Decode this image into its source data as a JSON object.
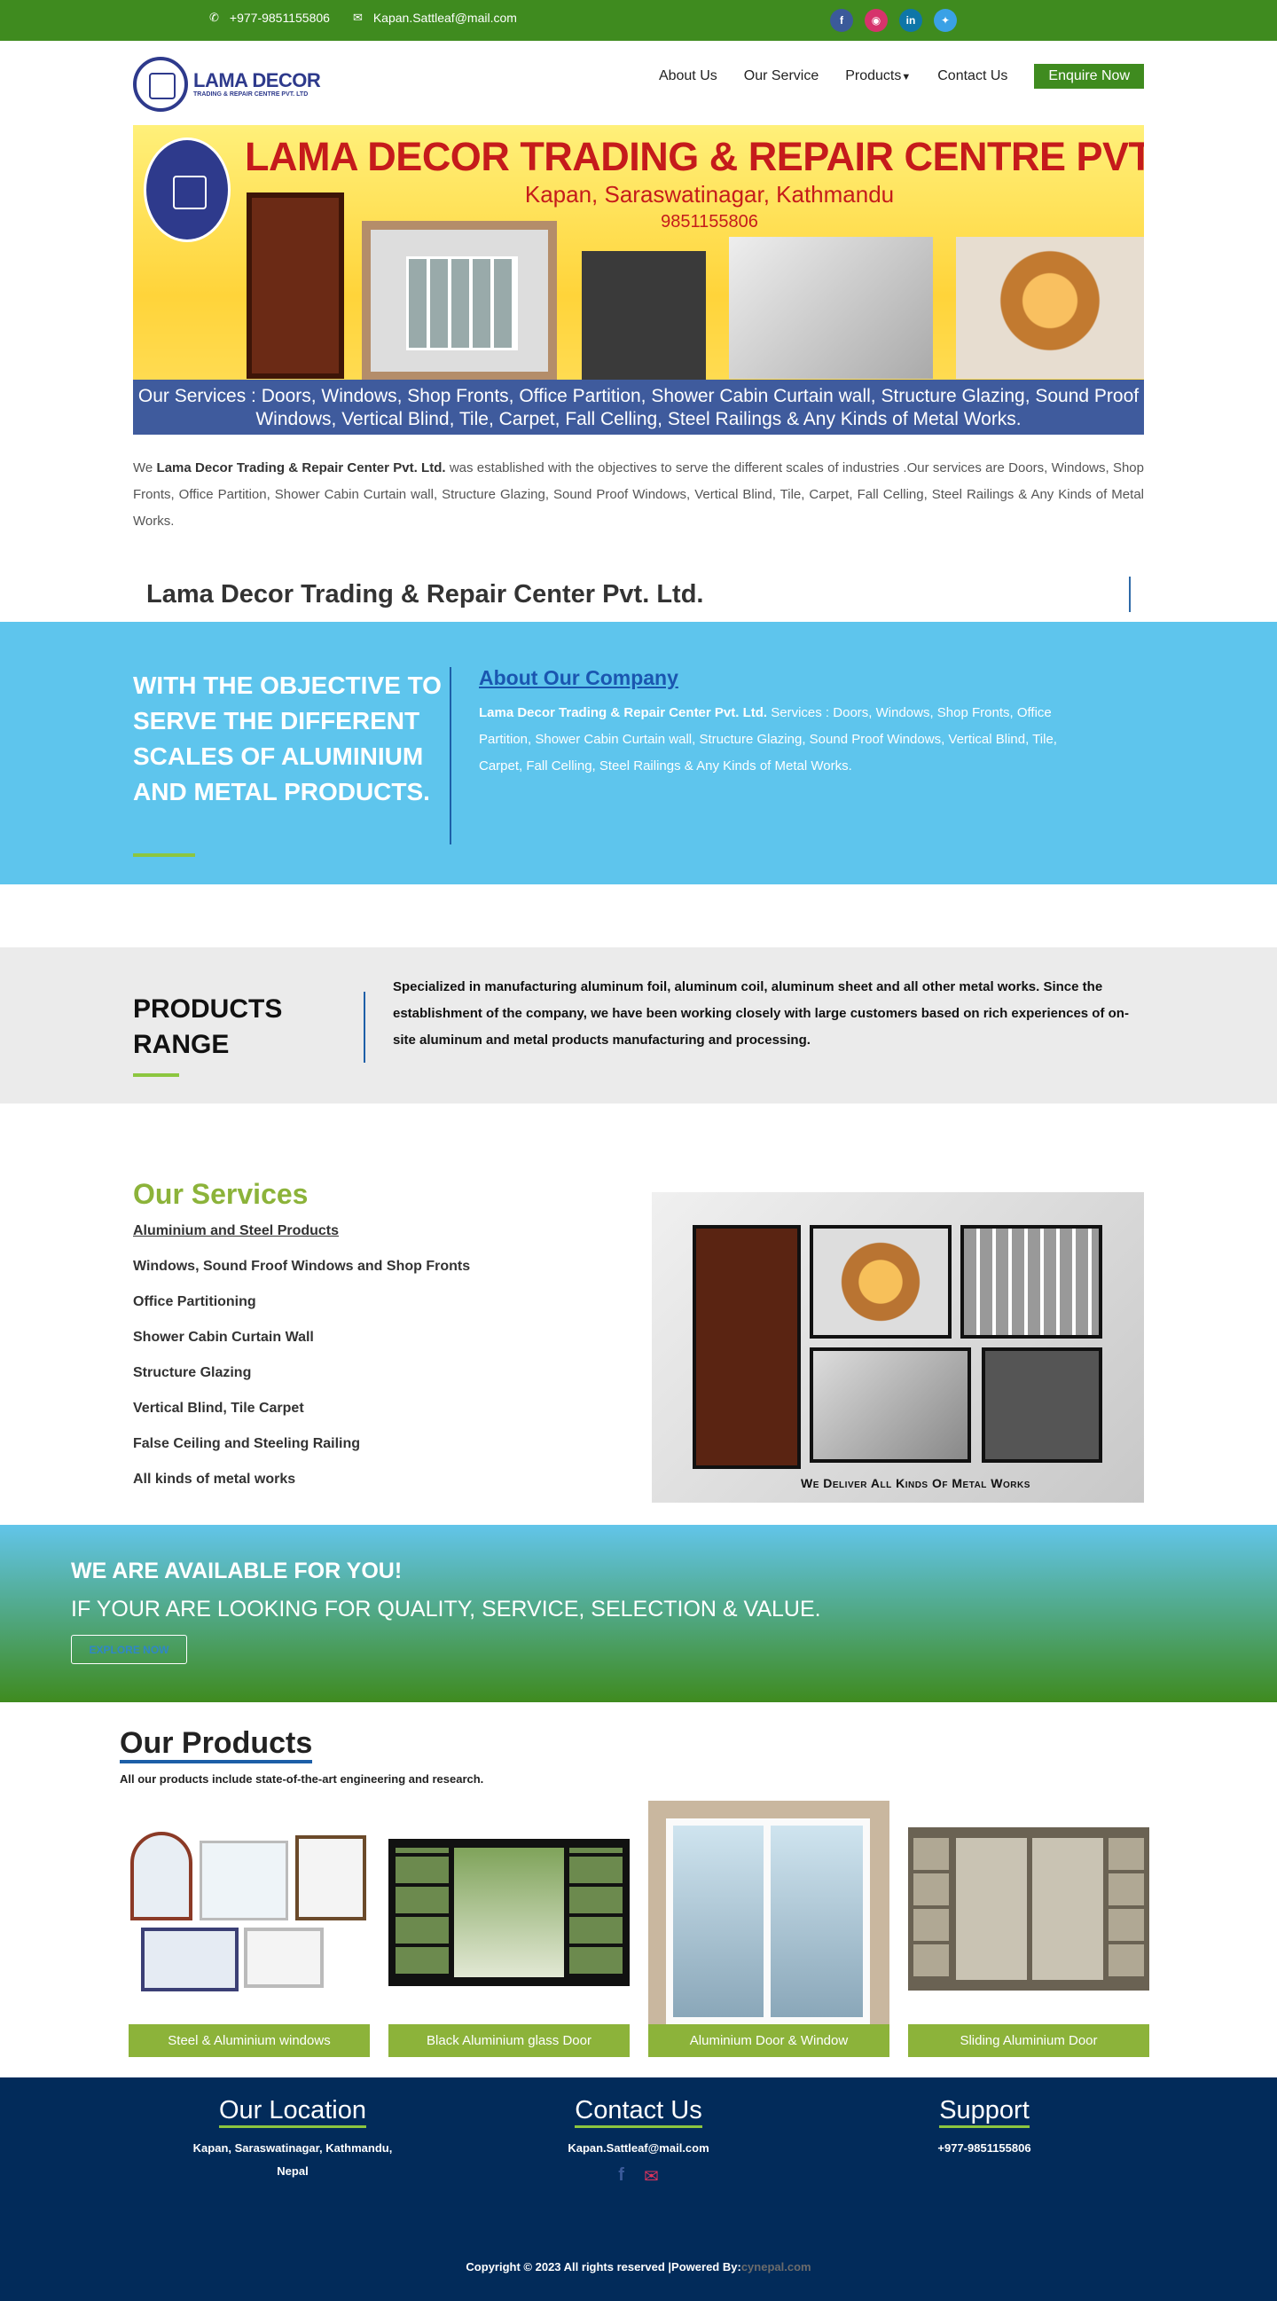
{
  "topbar": {
    "phone": "+977-9851155806",
    "email": "Kapan.Sattleaf@mail.com",
    "social": [
      "facebook-icon",
      "instagram-icon",
      "linkedin-icon",
      "twitter-icon"
    ]
  },
  "logo": {
    "title": "LAMA DECOR",
    "subtitle": "TRADING & REPAIR CENTRE PVT. LTD"
  },
  "nav": {
    "items": [
      "About Us",
      "Our Service",
      "Products",
      "Contact Us"
    ],
    "enquire": "Enquire Now"
  },
  "banner": {
    "title": "LAMA DECOR TRADING & REPAIR CENTRE PVT. LTD",
    "address": "Kapan, Saraswatinagar, Kathmandu",
    "phone": "9851155806",
    "services": "Our Services : Doors, Windows, Shop Fronts, Office Partition, Shower Cabin Curtain wall, Structure Glazing, Sound Proof Windows, Vertical Blind, Tile, Carpet, Fall Celling, Steel Railings & Any Kinds of Metal Works."
  },
  "intro": {
    "prefix": "We ",
    "company": "Lama Decor Trading & Repair Center Pvt. Ltd.",
    "text": " was established with the objectives to serve the different scales of industries .Our services are Doors, Windows, Shop Fronts, Office Partition, Shower Cabin Curtain wall, Structure Glazing, Sound Proof Windows, Vertical Blind, Tile, Carpet, Fall Celling, Steel Railings & Any Kinds of Metal Works."
  },
  "section_title": "Lama Decor Trading & Repair Center Pvt. Ltd.",
  "about": {
    "objective": "WITH THE OBJECTIVE TO SERVE THE DIFFERENT SCALES OF ALUMINIUM AND METAL PRODUCTS.",
    "heading": "About Our Company",
    "company": "Lama Decor Trading & Repair Center Pvt. Ltd.",
    "text": " Services : Doors, Windows, Shop Fronts, Office Partition, Shower Cabin Curtain wall, Structure Glazing, Sound Proof Windows, Vertical Blind, Tile, Carpet, Fall Celling, Steel Railings & Any Kinds of Metal Works."
  },
  "range": {
    "title": "PRODUCTS RANGE",
    "text": "Specialized in manufacturing aluminum foil, aluminum coil, aluminum sheet and all other metal works. Since the establishment of the company, we have been working closely with large customers based on rich experiences of on-site aluminum and metal products manufacturing and processing."
  },
  "services": {
    "title": "Our Services",
    "items": [
      "Aluminium and Steel Products",
      "Windows, Sound Froof Windows and Shop Fronts",
      "Office Partitioning",
      "Shower Cabin Curtain Wall",
      "Structure Glazing",
      "Vertical Blind, Tile Carpet",
      "False Ceiling and Steeling Railing",
      "All kinds of metal works"
    ],
    "image_caption": "We Deliver All Kinds Of Metal Works"
  },
  "cta": {
    "line1": "WE ARE AVAILABLE FOR YOU!",
    "line2": "IF YOUR ARE LOOKING FOR QUALITY, SERVICE, SELECTION & VALUE.",
    "button": "EXPLORE NOW"
  },
  "products": {
    "title": "Our Products",
    "subtitle": "All our products include state-of-the-art engineering and research.",
    "items": [
      "Steel & Aluminium windows",
      "Black Aluminium glass Door",
      "Aluminium Door & Window",
      "Sliding Aluminium Door"
    ]
  },
  "footer": {
    "location_title": "Our Location",
    "location_line1": "Kapan, Saraswatinagar, Kathmandu,",
    "location_line2": "Nepal",
    "contact_title": "Contact Us",
    "contact_email": "Kapan.Sattleaf@mail.com",
    "support_title": "Support",
    "support_phone": "+977-9851155806",
    "copyright": "Copyright © 2023 All rights reserved |Powered By:",
    "powered": "cynepal.com"
  },
  "colors": {
    "green": "#3f8b1f",
    "lightgreen": "#8cb33a",
    "sky": "#5ec5ed",
    "navy": "#022b5a",
    "blue": "#1d5fa8"
  }
}
